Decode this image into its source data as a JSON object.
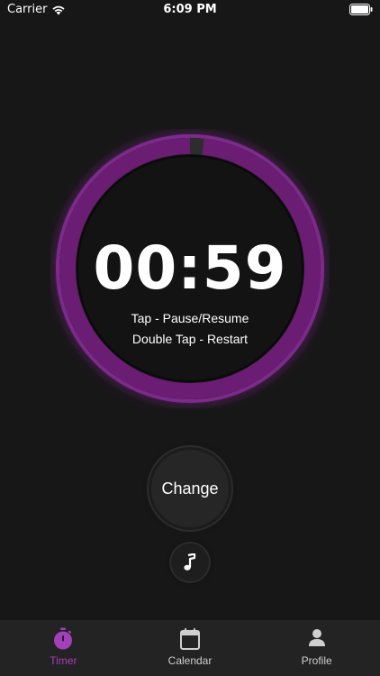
{
  "status_bar": {
    "carrier": "Carrier",
    "time": "6:09 PM"
  },
  "timer": {
    "time": "00:59",
    "progress_fraction": 0.983,
    "hint_tap": "Tap - Pause/Resume",
    "hint_double_tap": "Double Tap - Restart",
    "ring_color": "#6b1d73",
    "ring_glow_color": "#8a2a9a"
  },
  "controls": {
    "change_label": "Change",
    "music_icon": "music-note-icon"
  },
  "tab_bar": {
    "accent_color": "#a23fb9",
    "tabs": [
      {
        "label": "Timer",
        "icon": "stopwatch-icon",
        "active": true
      },
      {
        "label": "Calendar",
        "icon": "calendar-icon",
        "active": false
      },
      {
        "label": "Profile",
        "icon": "person-icon",
        "active": false
      }
    ]
  }
}
